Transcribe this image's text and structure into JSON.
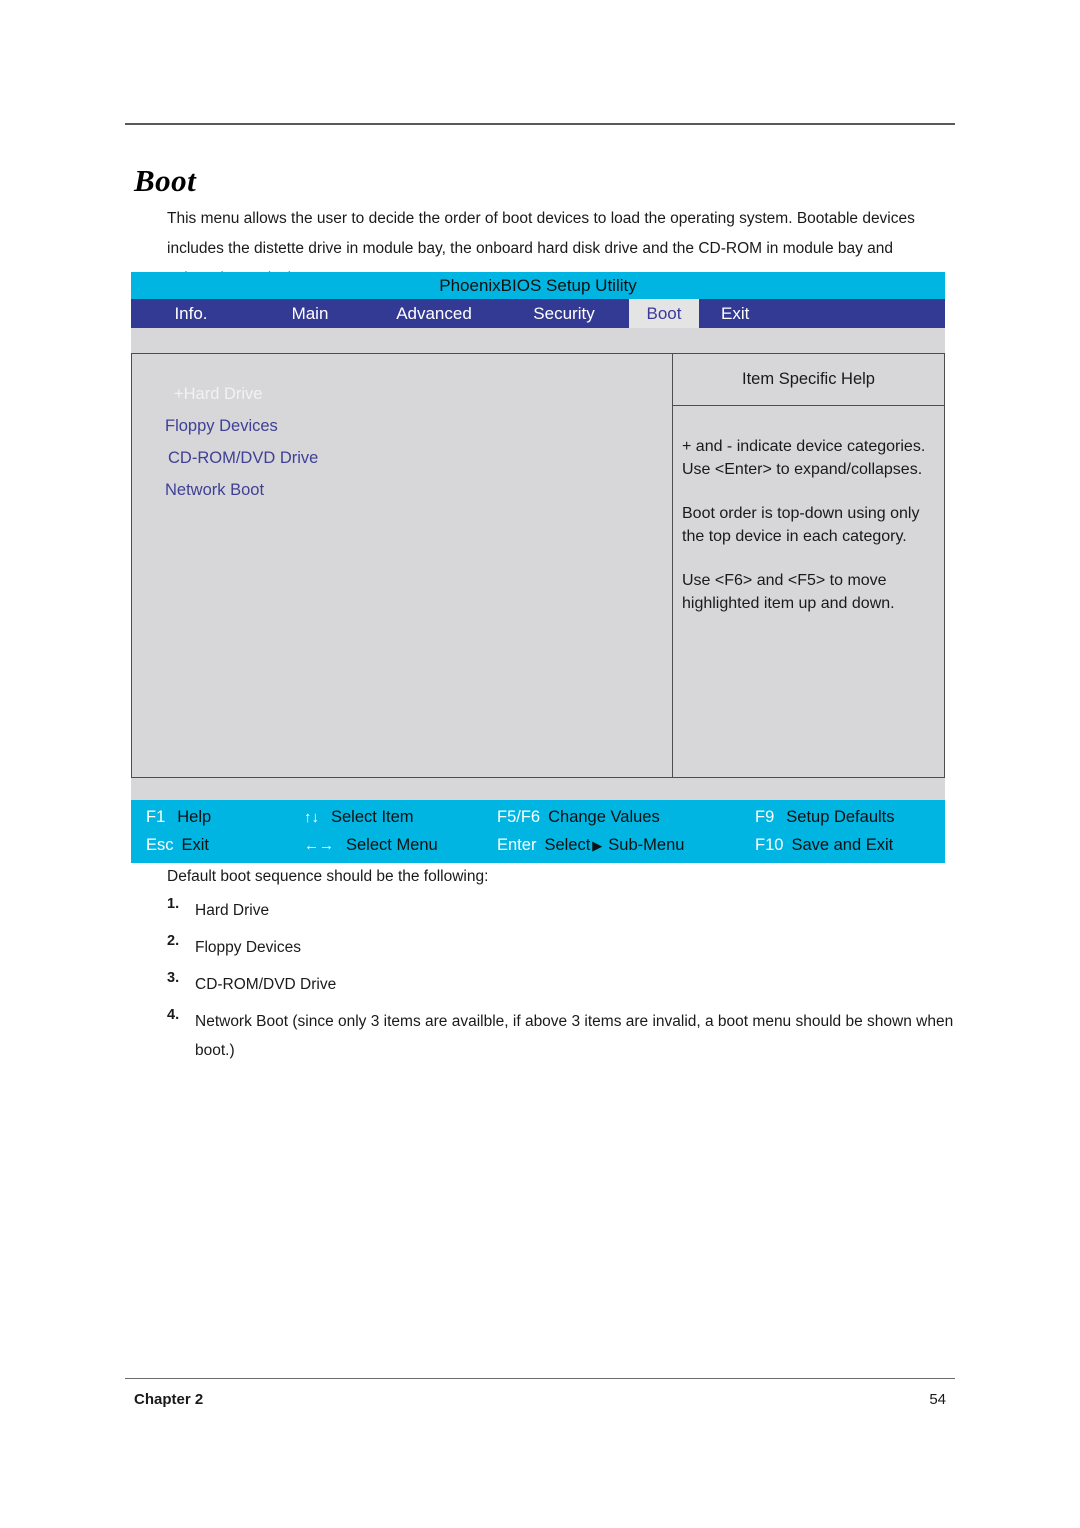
{
  "page": {
    "heading": "Boot",
    "intro": "This menu allows the user to decide the order of boot devices to load the operating system. Bootable devices includes the distette drive in module bay, the onboard hard disk drive and the CD-ROM in module bay and onboard LAN device."
  },
  "bios": {
    "title": "PhoenixBIOS Setup Utility",
    "tabs": [
      {
        "label": "Info.",
        "active": false
      },
      {
        "label": "Main",
        "active": false
      },
      {
        "label": "Advanced",
        "active": false
      },
      {
        "label": "Security",
        "active": false
      },
      {
        "label": "Boot",
        "active": true
      },
      {
        "label": "Exit",
        "active": false
      }
    ],
    "boot_items": [
      {
        "label": "+Hard Drive",
        "selected": true
      },
      {
        "label": "Floppy Devices",
        "selected": false
      },
      {
        "label": "CD-ROM/DVD Drive",
        "selected": false
      },
      {
        "label": "Network Boot",
        "selected": false
      }
    ],
    "help": {
      "header": "Item Specific Help",
      "paragraphs": [
        "+ and - indicate device categories. Use  <Enter> to expand/collapses.",
        "Boot order is top-down using only the top device in each category.",
        "Use <F6> and <F5> to move highlighted item up and down."
      ]
    },
    "keys": {
      "row1": [
        {
          "name": "F1",
          "desc": "Help"
        },
        {
          "name": "↑↓",
          "desc": "Select Item"
        },
        {
          "name": "F5/F6",
          "desc": "Change Values"
        },
        {
          "name": "F9",
          "desc": "Setup Defaults"
        }
      ],
      "row2": [
        {
          "name": "Esc",
          "desc": "Exit"
        },
        {
          "name": "←→",
          "desc": "Select Menu"
        },
        {
          "name": "Enter",
          "desc": "Select",
          "desc2": "Sub-Menu",
          "glyph": "▶"
        },
        {
          "name": "F10",
          "desc": "Save and Exit"
        }
      ]
    }
  },
  "sequence": {
    "lead": "Default boot sequence should be the following:",
    "items": [
      {
        "num": "1.",
        "text": "Hard Drive"
      },
      {
        "num": "2.",
        "text": "Floppy Devices"
      },
      {
        "num": "3.",
        "text": "CD-ROM/DVD Drive"
      },
      {
        "num": "4.",
        "text": "Network Boot (since only 3 items are availble, if above 3 items are invalid, a boot menu should be shown when boot.)"
      }
    ]
  },
  "footer": {
    "chapter": "Chapter 2",
    "page_number": "54"
  },
  "colors": {
    "title_bar": "#00b5e2",
    "tab_bar": "#333a93",
    "active_tab_bg": "#e4e4e4",
    "active_tab_text": "#3a3a9c",
    "panel_bg": "#d7d7d9",
    "item_text": "#3f4096"
  }
}
